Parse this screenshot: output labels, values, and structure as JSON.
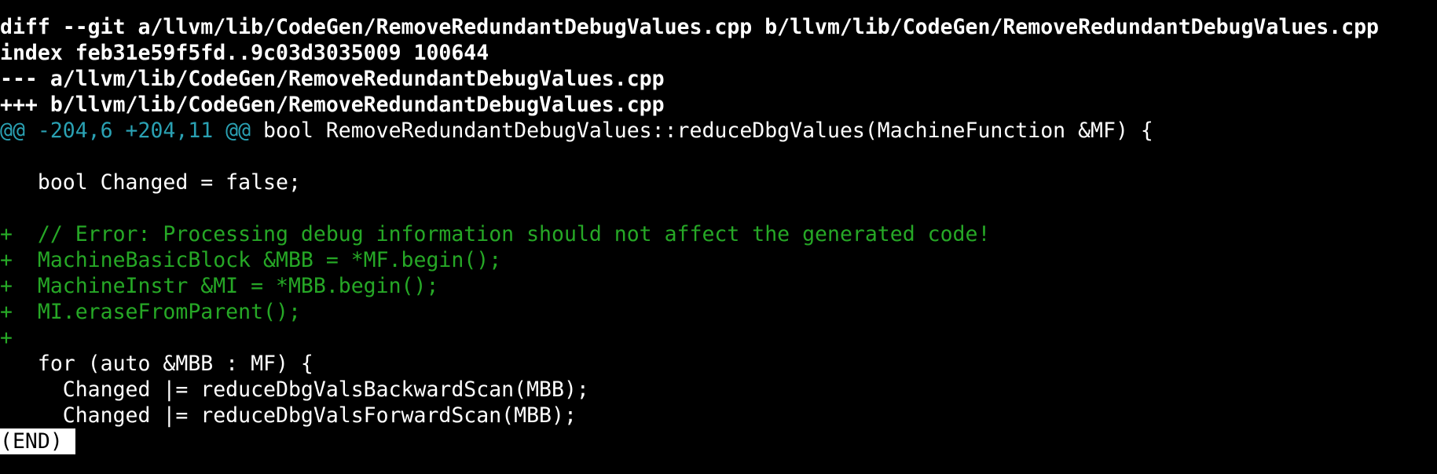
{
  "terminal": {
    "header": {
      "diff_line": "diff --git a/llvm/lib/CodeGen/RemoveRedundantDebugValues.cpp b/llvm/lib/CodeGen/RemoveRedundantDebugValues.cpp",
      "index_line": "index feb31e59f5fd..9c03d3035009 100644",
      "minus_file": "--- a/llvm/lib/CodeGen/RemoveRedundantDebugValues.cpp",
      "plus_file": "+++ b/llvm/lib/CodeGen/RemoveRedundantDebugValues.cpp"
    },
    "hunk": {
      "range": "@@ -204,6 +204,11 @@",
      "context": " bool RemoveRedundantDebugValues::reduceDbgValues(MachineFunction &MF) {"
    },
    "lines": [
      "",
      "   bool Changed = false;",
      "",
      "+  // Error: Processing debug information should not affect the generated code!",
      "+  MachineBasicBlock &MBB = *MF.begin();",
      "+  MachineInstr &MI = *MBB.begin();",
      "+  MI.eraseFromParent();",
      "+",
      "   for (auto &MBB : MF) {",
      "     Changed |= reduceDbgValsBackwardScan(MBB);",
      "     Changed |= reduceDbgValsForwardScan(MBB);"
    ],
    "pager_status": "(END)",
    "colors": {
      "background": "#000000",
      "text": "#ffffff",
      "added": "#26a826",
      "hunk_marker": "#2aa1b3"
    }
  }
}
